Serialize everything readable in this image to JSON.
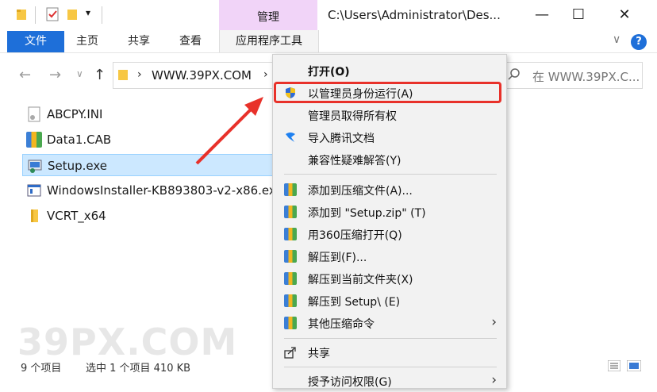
{
  "title_bar": {
    "manage_tab": "管理",
    "path": "C:\\Users\\Administrator\\Des...",
    "minimize": "—",
    "maximize": "☐",
    "close": "✕"
  },
  "ribbon": {
    "tabs": [
      "文件",
      "主页",
      "共享",
      "查看",
      "应用程序工具"
    ],
    "help": "?"
  },
  "address": {
    "path": "WWW.39PX.COM",
    "search_placeholder": "在 WWW.39PX.C..."
  },
  "files": [
    {
      "name": "ABCPY.INI",
      "icon": "ini-file-icon"
    },
    {
      "name": "Data1.CAB",
      "icon": "cab-archive-icon"
    },
    {
      "name": "Setup.exe",
      "icon": "setup-exe-icon",
      "selected": true
    },
    {
      "name": "WindowsInstaller-KB893803-v2-x86.exe",
      "icon": "installer-exe-icon"
    },
    {
      "name": "VCRT_x64",
      "icon": "folder-icon"
    }
  ],
  "status": {
    "item_count": "9 个项目",
    "selection": "选中 1 个项目  410 KB"
  },
  "watermark": "39PX.COM",
  "context_menu": {
    "items": [
      {
        "label": "打开(O)",
        "bold": true
      },
      {
        "label": "以管理员身份运行(A)",
        "icon": "uac-shield-icon"
      },
      {
        "label": "管理员取得所有权"
      },
      {
        "label": "导入腾讯文档",
        "icon": "tencent-docs-icon"
      },
      {
        "label": "兼容性疑难解答(Y)"
      },
      {
        "label": "添加到压缩文件(A)...",
        "icon": "compress-icon"
      },
      {
        "label": "添加到 \"Setup.zip\" (T)",
        "icon": "compress-icon"
      },
      {
        "label": "用360压缩打开(Q)",
        "icon": "compress-icon"
      },
      {
        "label": "解压到(F)...",
        "icon": "compress-icon"
      },
      {
        "label": "解压到当前文件夹(X)",
        "icon": "compress-icon"
      },
      {
        "label": "解压到 Setup\\ (E)",
        "icon": "compress-icon"
      },
      {
        "label": "其他压缩命令",
        "icon": "compress-icon",
        "submenu": true
      },
      {
        "label": "共享",
        "icon": "share-icon"
      },
      {
        "label": "授予访问权限(G)",
        "submenu": true
      }
    ]
  },
  "colors": {
    "file_tab": "#1e6fd9",
    "manage_band": "#f1d4f8",
    "selection": "#cce8ff",
    "highlight_box": "#e8312a",
    "arrow": "#e8312a"
  }
}
